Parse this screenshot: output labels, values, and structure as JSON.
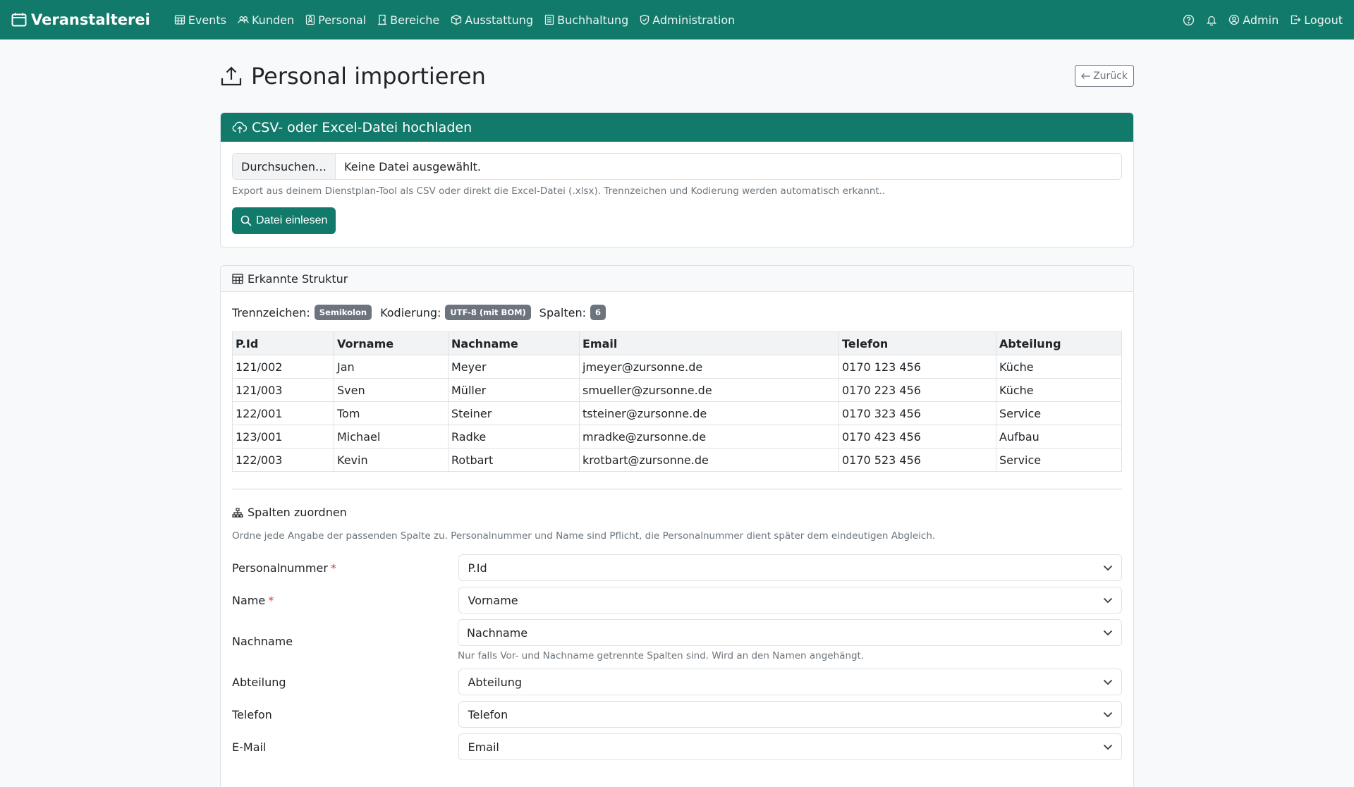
{
  "nav": {
    "brand": "Veranstalterei",
    "links": [
      {
        "label": "Events",
        "icon": "calendar-grid-icon"
      },
      {
        "label": "Kunden",
        "icon": "people-icon"
      },
      {
        "label": "Personal",
        "icon": "badge-icon"
      },
      {
        "label": "Bereiche",
        "icon": "door-icon"
      },
      {
        "label": "Ausstattung",
        "icon": "box-icon"
      },
      {
        "label": "Buchhaltung",
        "icon": "ledger-icon"
      },
      {
        "label": "Administration",
        "icon": "shield-icon"
      }
    ],
    "admin": "Admin",
    "logout": "Logout"
  },
  "page": {
    "title": "Personal importieren",
    "back": "Zurück"
  },
  "upload": {
    "header": "CSV- oder Excel-Datei hochladen",
    "browse": "Durchsuchen…",
    "file_status": "Keine Datei ausgewählt.",
    "help": "Export aus deinem Dienstplan-Tool als CSV oder direkt die Excel-Datei (.xlsx). Trennzeichen und Kodierung werden automatisch erkannt..",
    "button": "Datei einlesen"
  },
  "structure": {
    "header": "Erkannte Struktur",
    "delimiter_label": "Trennzeichen:",
    "delimiter": "Semikolon",
    "encoding_label": "Kodierung:",
    "encoding": "UTF-8 (mit BOM)",
    "columns_label": "Spalten:",
    "columns": "6",
    "table": {
      "headers": [
        "P.Id",
        "Vorname",
        "Nachname",
        "Email",
        "Telefon",
        "Abteilung"
      ],
      "rows": [
        [
          "121/002",
          "Jan",
          "Meyer",
          "jmeyer@zursonne.de",
          "0170 123 456",
          "Küche"
        ],
        [
          "121/003",
          "Sven",
          "Müller",
          "smueller@zursonne.de",
          "0170 223 456",
          "Küche"
        ],
        [
          "122/001",
          "Tom",
          "Steiner",
          "tsteiner@zursonne.de",
          "0170 323 456",
          "Service"
        ],
        [
          "123/001",
          "Michael",
          "Radke",
          "mradke@zursonne.de",
          "0170 423 456",
          "Aufbau"
        ],
        [
          "122/003",
          "Kevin",
          "Rotbart",
          "krotbart@zursonne.de",
          "0170 523 456",
          "Service"
        ]
      ]
    }
  },
  "mapping": {
    "title": "Spalten zuordnen",
    "text": "Ordne jede Angabe der passenden Spalte zu. Personalnummer und Name sind Pflicht, die Personalnummer dient später dem eindeutigen Abgleich.",
    "fields": [
      {
        "label": "Personalnummer",
        "required": true,
        "value": "P.Id",
        "help": ""
      },
      {
        "label": "Name",
        "required": true,
        "value": "Vorname",
        "help": ""
      },
      {
        "label": "Nachname",
        "required": false,
        "value": "Nachname",
        "help": "Nur falls Vor- und Nachname getrennte Spalten sind. Wird an den Namen angehängt."
      },
      {
        "label": "Abteilung",
        "required": false,
        "value": "Abteilung",
        "help": ""
      },
      {
        "label": "Telefon",
        "required": false,
        "value": "Telefon",
        "help": ""
      },
      {
        "label": "E-Mail",
        "required": false,
        "value": "Email",
        "help": ""
      }
    ]
  },
  "colors": {
    "primary": "#127a6a",
    "secondary_badge": "#6c757d",
    "required": "#dc3545"
  }
}
